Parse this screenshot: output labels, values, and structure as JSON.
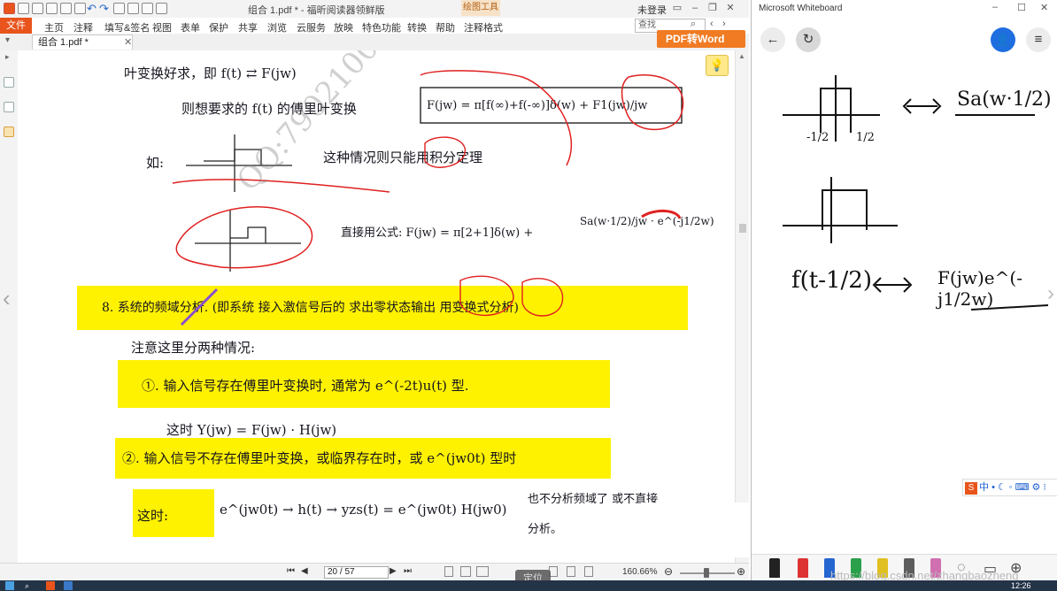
{
  "pdf_app": {
    "title": "组合 1.pdf * - 福昕阅读器领鲜版",
    "draw_tools_label": "绘图工具",
    "login_label": "未登录",
    "menu": {
      "file": "文件",
      "items": [
        "主页",
        "注释",
        "填写&签名",
        "视图",
        "表单",
        "保护",
        "共享",
        "浏览",
        "云服务",
        "放映",
        "特色功能",
        "转换",
        "帮助",
        "注释格式"
      ]
    },
    "search_placeholder": "查找",
    "tab_label": "组合 1.pdf *",
    "pdf_to_word": "PDF转Word",
    "page_indicator": "20 / 57",
    "zoom": "160.66%",
    "locate_label": "定位",
    "watermark": "QQ:790210071",
    "notes": {
      "line_ft": "叶变换好求，即 f(t) ⇄ F(jw)",
      "line_then": "则想要求的 f(t) 的傅里叶变换",
      "line_formula1": "F(jw) = π[f(∞)+f(-∞)]δ(w) + F1(jw)/jw",
      "line_example": "如:",
      "line_case": "这种情况则只能用积分定理",
      "line_direct": "直接用公式: F(jw) = π[2+1]δ(w) +",
      "line_direct_frac": "Sa(w·1/2)/jw · e^(-j1/2w)",
      "section8": "8. 系统的频域分析. (即系统 接入激信号后的 求出零状态输出 用变换式分析)",
      "note_two_cases": "注意这里分两种情况:",
      "case1": "①. 输入信号存在傅里叶变换时, 通常为 e^(-2t)u(t) 型.",
      "case1_eq": "这时 Y(jw) = F(jw) · H(jw)",
      "case2": "②. 输入信号不存在傅里叶变换，或临界存在时，或 e^(jw0t) 型时",
      "case2_label": "这时:",
      "case2_eq": "e^(jw0t) → h(t) → yzs(t) = e^(jw0t) H(jw0)",
      "case2_tail": "也不分析频域了 或不直接",
      "case2_tail2": "分析。"
    }
  },
  "whiteboard": {
    "title": "Microsoft Whiteboard",
    "sketch": {
      "rect_label_half": "1/2",
      "rect_label_neghalf": "-1/2",
      "sa_text": "Sa(w·1/2)",
      "shift_eq_left": "f(t-1/2)",
      "shift_eq_right": "F(jw)e^(-j1/2w)"
    },
    "ime_label": "中"
  },
  "taskbar": {
    "clock": "12:26",
    "csdn": "https://blog.csdn.net/zhangbaozheng"
  }
}
